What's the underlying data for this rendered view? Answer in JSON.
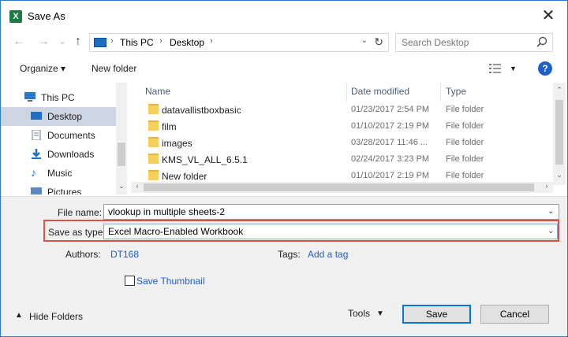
{
  "window": {
    "title": "Save As",
    "app_icon": "X"
  },
  "nav": {
    "back_icon": "←",
    "forward_icon": "→",
    "recent_icon": "⌄",
    "up_icon": "↑",
    "breadcrumb": [
      "This PC",
      "Desktop"
    ],
    "search_placeholder": "Search Desktop"
  },
  "toolbar": {
    "organize_label": "Organize ▾",
    "new_folder_label": "New folder",
    "help_label": "?"
  },
  "sidebar": {
    "items": [
      {
        "label": "This PC"
      },
      {
        "label": "Desktop"
      },
      {
        "label": "Documents"
      },
      {
        "label": "Downloads"
      },
      {
        "label": "Music"
      },
      {
        "label": "Pictures"
      }
    ]
  },
  "columns": {
    "name": "Name",
    "date": "Date modified",
    "type": "Type"
  },
  "files": [
    {
      "name": "datavallistboxbasic",
      "date": "01/23/2017 2:54 PM",
      "type": "File folder"
    },
    {
      "name": "film",
      "date": "01/10/2017 2:19 PM",
      "type": "File folder"
    },
    {
      "name": "images",
      "date": "03/28/2017 11:46 ...",
      "type": "File folder"
    },
    {
      "name": "KMS_VL_ALL_6.5.1",
      "date": "02/24/2017 3:23 PM",
      "type": "File folder"
    },
    {
      "name": "New folder",
      "date": "01/10/2017 2:19 PM",
      "type": "File folder"
    }
  ],
  "form": {
    "file_name_label": "File name:",
    "file_name_value": "vlookup in multiple sheets-2",
    "save_type_label": "Save as type:",
    "save_type_value": "Excel Macro-Enabled Workbook",
    "authors_label": "Authors:",
    "authors_value": "DT168",
    "tags_label": "Tags:",
    "tags_value": "Add a tag",
    "thumbnail_label": "Save Thumbnail"
  },
  "footer": {
    "hide_folders_label": "Hide Folders",
    "tools_label": "Tools",
    "save_label": "Save",
    "cancel_label": "Cancel"
  },
  "colors": {
    "accent": "#0078d7",
    "highlight": "#e0504a",
    "link": "#1f5fc7",
    "selected_bg": "#ccd5e1"
  }
}
